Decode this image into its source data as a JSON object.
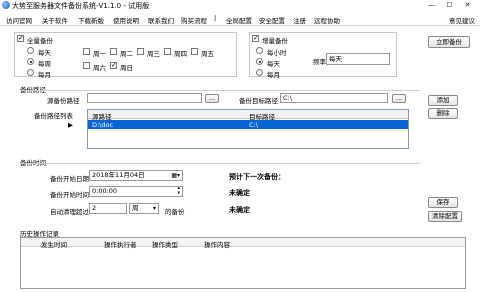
{
  "window": {
    "title": "大势至服务器文件备份系统-V1.1.0 - 试用版",
    "minimize": "—",
    "maximize": "☐",
    "close": "✕"
  },
  "menu": {
    "items": [
      "访问官网",
      "关于软件",
      "下载新版",
      "使用说明",
      "联系我们",
      "购买流程",
      "全局配置",
      "安全配置",
      "注册",
      "远程协助"
    ],
    "separator": "|",
    "right": "意见建议"
  },
  "full_backup": {
    "label": "全量备份",
    "checked": true,
    "options": [
      "每天",
      "每周",
      "每月"
    ],
    "selected": "每周",
    "weekdays": [
      {
        "label": "周一",
        "checked": false
      },
      {
        "label": "周二",
        "checked": false
      },
      {
        "label": "周三",
        "checked": false
      },
      {
        "label": "周四",
        "checked": false
      },
      {
        "label": "周五",
        "checked": false
      },
      {
        "label": "周六",
        "checked": false
      },
      {
        "label": "周日",
        "checked": true
      }
    ]
  },
  "incremental_backup": {
    "label": "增量备份",
    "checked": true,
    "options": [
      "每小时",
      "每天",
      "每月"
    ],
    "selected": "每天",
    "freq_label": "频率",
    "freq_value": "每天"
  },
  "buttons": {
    "backup_now": "立即备份",
    "add": "添加",
    "delete": "删除",
    "save": "保存",
    "clear_config": "清除配置",
    "browse": "..."
  },
  "backup_path": {
    "section": "备份路径",
    "source_label": "源备份路径",
    "source_value": "",
    "target_label": "备份目标路径",
    "target_value": "C:\\",
    "list_label": "备份路径列表",
    "columns": [
      "源路径",
      "目标路径"
    ],
    "rows": [
      {
        "marker": "▶",
        "source": "D:\\doc",
        "target": "C:\\"
      }
    ]
  },
  "backup_time": {
    "section": "备份时间",
    "start_date_label": "备份开始日期",
    "start_date_value": "2018年11月04日",
    "start_time_label": "备份开始时间",
    "start_time_value": "0:00:00",
    "auto_clean_label": "自动清理超过",
    "auto_clean_value": "2",
    "auto_clean_unit": "周",
    "auto_clean_suffix": "的备份",
    "next_label": "预计下一次备份：",
    "status1": "未确定",
    "status2": "未确定"
  },
  "history": {
    "section": "历史操作记录",
    "columns": [
      "发生时间",
      "操作执行者",
      "操作类型",
      "操作内容"
    ]
  },
  "colors": {
    "selection": "#0a64d2",
    "border": "#c8c8c8",
    "accent": "#3c7fd8"
  }
}
